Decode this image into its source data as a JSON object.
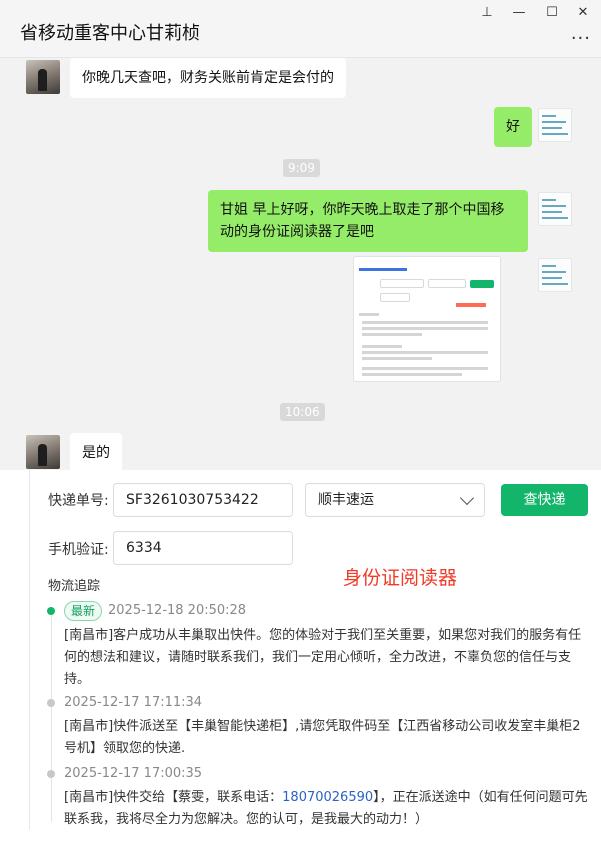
{
  "window": {
    "title": "省移动重客中心甘莉桢",
    "controls": {
      "pin": "⊥",
      "minimize": "—",
      "maximize": "☐",
      "close": "✕",
      "more": "···"
    }
  },
  "chat": {
    "messages": [
      {
        "side": "left",
        "text": "你晚几天查吧，财务关账前肯定是会付的"
      },
      {
        "side": "right",
        "text": "好"
      },
      {
        "type": "timestamp",
        "text": "9:09"
      },
      {
        "side": "right",
        "text": "甘姐 早上好呀，你昨天晚上取走了那个中国移动的身份证阅读器了是吧"
      },
      {
        "side": "right",
        "type": "image",
        "alt": "courier-tracking-screenshot"
      },
      {
        "type": "timestamp",
        "text": "10:06"
      },
      {
        "side": "left",
        "text": "是的"
      }
    ]
  },
  "courier": {
    "tracking_label": "快递单号:",
    "tracking_value": "SF3261030753422",
    "carrier": "顺丰速运",
    "query_button": "查快递",
    "phone_label": "手机验证:",
    "phone_value": "6334",
    "annotation": "身份证阅读器",
    "track_title": "物流追踪",
    "events": [
      {
        "badge": "最新",
        "time": "2025-12-18 20:50:28",
        "text": "[南昌市]客户成功从丰巢取出快件。您的体验对于我们至关重要，如果您对我们的服务有任何的想法和建议，请随时联系我们，我们一定用心倾听，全力改进，不辜负您的信任与支持。"
      },
      {
        "time": "2025-12-17 17:11:34",
        "text": "[南昌市]快件派送至【丰巢智能快递柜】,请您凭取件码至【江西省移动公司收发室丰巢柜2号机】领取您的快递."
      },
      {
        "time": "2025-12-17 17:00:35",
        "text_before": "[南昌市]快件交给【蔡雯，联系电话：",
        "phone": "18070026590",
        "text_after": "】，正在派送途中（如有任何问题可先联系我，我将尽全力为您解决。您的认可，是我最大的动力！）"
      }
    ]
  },
  "colors": {
    "accent_green": "#12b56a",
    "bubble_out": "#95ec69",
    "annotation_red": "#f23a28",
    "phone_link": "#2a62c7"
  }
}
